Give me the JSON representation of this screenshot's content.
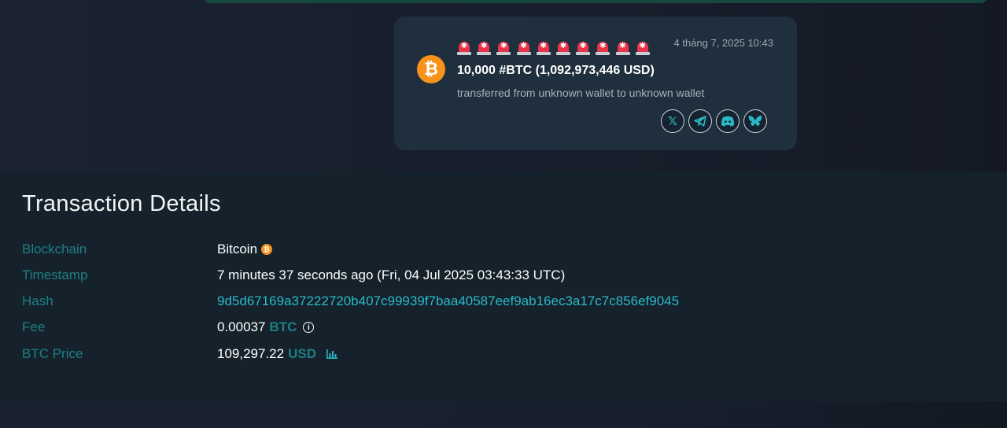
{
  "alert": {
    "siren_count": 10,
    "timestamp": "4 tháng 7, 2025 10:43",
    "headline": "10,000 #BTC (1,092,973,446 USD)",
    "subtitle": "transferred from unknown wallet to unknown wallet",
    "coin_symbol": "₿",
    "share": [
      {
        "name": "x-share-button",
        "icon": "x-icon",
        "glyph": "𝕏"
      },
      {
        "name": "telegram-share-button",
        "icon": "telegram-icon",
        "glyph": "➤"
      },
      {
        "name": "discord-share-button",
        "icon": "discord-icon",
        "glyph": "◕"
      },
      {
        "name": "bluesky-share-button",
        "icon": "bluesky-icon",
        "glyph": "❦"
      }
    ]
  },
  "details": {
    "title": "Transaction Details",
    "blockchain": {
      "label": "Blockchain",
      "value": "Bitcoin",
      "icon": "bitcoin-icon"
    },
    "timestamp": {
      "label": "Timestamp",
      "value": "7 minutes 37 seconds ago (Fri, 04 Jul 2025 03:43:33 UTC)"
    },
    "hash": {
      "label": "Hash",
      "value": "9d5d67169a37222720b407c99939f7baa40587eef9ab16ec3a17c7c856ef9045"
    },
    "fee": {
      "label": "Fee",
      "value": "0.00037",
      "unit": "BTC",
      "icon": "info-icon"
    },
    "price": {
      "label": "BTC Price",
      "value": "109,297.22",
      "unit": "USD",
      "icon": "bar-chart-icon"
    }
  },
  "colors": {
    "accent": "#2bb9c9",
    "label": "#1f7f86",
    "bitcoin": "#f7931a",
    "siren": "#e8344b",
    "card": "#1f2f3d",
    "details_bg": "#15222b"
  }
}
